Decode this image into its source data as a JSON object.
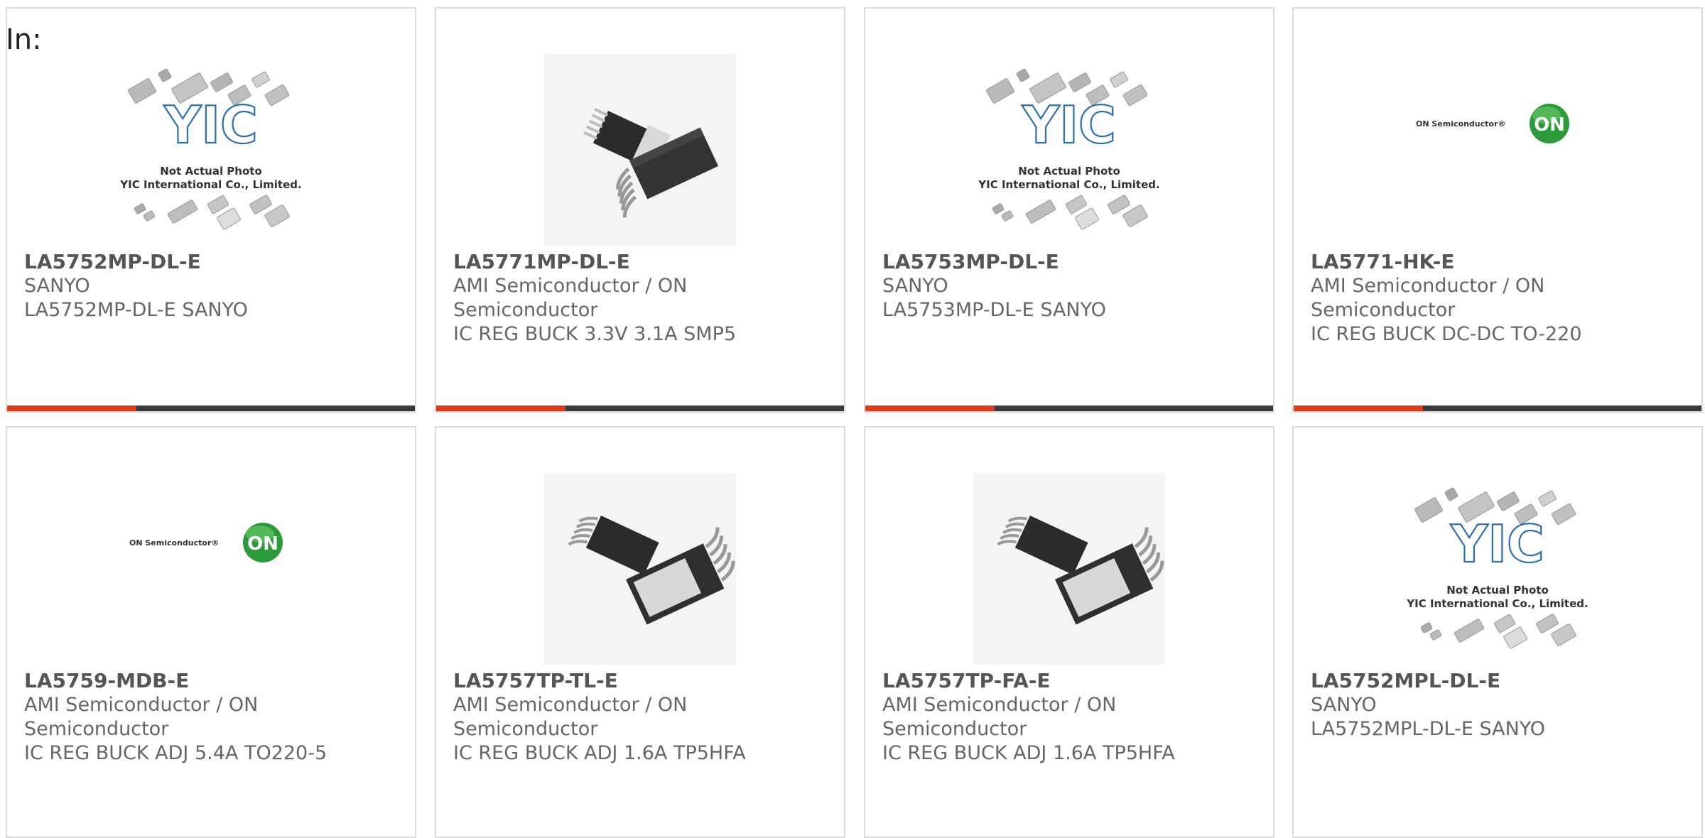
{
  "page": {
    "in_label": "In:"
  },
  "theme": {
    "accent": "#e03a1a",
    "bar": "#3a3a3a",
    "border": "#dcdcdc"
  },
  "products": [
    {
      "part": "LA5752MP-DL-E",
      "maker": "SANYO",
      "desc": "LA5752MP-DL-E SANYO",
      "image": "yic-placeholder",
      "image_caption": [
        "Not Actual Photo",
        "YIC International Co., Limited."
      ]
    },
    {
      "part": "LA5771MP-DL-E",
      "maker": "AMI Semiconductor / ON Semiconductor",
      "desc": "IC REG BUCK 3.3V 3.1A SMP5",
      "image": "smd-package-tabbed"
    },
    {
      "part": "LA5753MP-DL-E",
      "maker": "SANYO",
      "desc": "LA5753MP-DL-E SANYO",
      "image": "yic-placeholder",
      "image_caption": [
        "Not Actual Photo",
        "YIC International Co., Limited."
      ]
    },
    {
      "part": "LA5771-HK-E",
      "maker": "AMI Semiconductor / ON Semiconductor",
      "desc": "IC REG BUCK DC-DC TO-220",
      "image": "on-semiconductor-logo",
      "logo_text": "ON Semiconductor",
      "logo_badge": "ON"
    },
    {
      "part": "LA5759-MDB-E",
      "maker": "AMI Semiconductor / ON Semiconductor",
      "desc": "IC REG BUCK ADJ 5.4A TO220-5",
      "image": "on-semiconductor-logo",
      "logo_text": "ON Semiconductor",
      "logo_badge": "ON"
    },
    {
      "part": "LA5757TP-TL-E",
      "maker": "AMI Semiconductor / ON Semiconductor",
      "desc": "IC REG BUCK ADJ 1.6A TP5HFA",
      "image": "smd-package-pad"
    },
    {
      "part": "LA5757TP-FA-E",
      "maker": "AMI Semiconductor / ON Semiconductor",
      "desc": "IC REG BUCK ADJ 1.6A TP5HFA",
      "image": "smd-package-pad"
    },
    {
      "part": "LA5752MPL-DL-E",
      "maker": "SANYO",
      "desc": "LA5752MPL-DL-E SANYO",
      "image": "yic-placeholder",
      "image_caption": [
        "Not Actual Photo",
        "YIC International Co., Limited."
      ]
    }
  ]
}
